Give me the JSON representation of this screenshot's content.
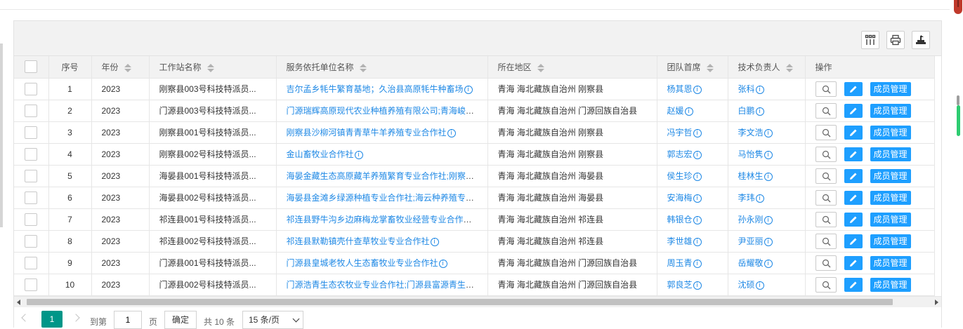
{
  "toolbar": {
    "columns_icon": "columns-icon",
    "print_icon": "print-icon",
    "export_icon": "export-icon"
  },
  "table": {
    "headers": {
      "seq": "序号",
      "year": "年份",
      "station": "工作站名称",
      "service_unit": "服务依托单位名称",
      "region": "所在地区",
      "chief": "团队首席",
      "tech_lead": "技术负责人",
      "ops": "操作"
    },
    "member_label": "成员管理",
    "rows": [
      {
        "seq": "1",
        "year": "2023",
        "station": "刚察县003号科技特派员...",
        "service_unit": "吉尔孟乡牦牛繁育基地；久治县高原牦牛种畜场",
        "region": "青海 海北藏族自治州 刚察县",
        "chief": "杨其恩",
        "tech_lead": "张科"
      },
      {
        "seq": "2",
        "year": "2023",
        "station": "门源县003号科技特派员...",
        "service_unit": "门源瑞辉高原现代农业种植养殖有限公司;青海峻帮农业",
        "region": "青海 海北藏族自治州 门源回族自治县",
        "chief": "赵媛",
        "tech_lead": "白鹏"
      },
      {
        "seq": "3",
        "year": "2023",
        "station": "刚察县001号科技特派员...",
        "service_unit": "刚察县沙柳河镇青青草牛羊养殖专业合作社",
        "region": "青海 海北藏族自治州 刚察县",
        "chief": "冯宇哲",
        "tech_lead": "李文浩"
      },
      {
        "seq": "4",
        "year": "2023",
        "station": "刚察县002号科技特派员...",
        "service_unit": "金山畜牧业合作社",
        "region": "青海 海北藏族自治州 刚察县",
        "chief": "郭志宏",
        "tech_lead": "马怡隽"
      },
      {
        "seq": "5",
        "year": "2023",
        "station": "海晏县001号科技特派员...",
        "service_unit": "海晏金藏生态高原藏羊养殖繁育专业合作社;刚察县沙流",
        "region": "青海 海北藏族自治州 海晏县",
        "chief": "侯生珍",
        "tech_lead": "桂林生"
      },
      {
        "seq": "6",
        "year": "2023",
        "station": "海晏县002号科技特派员...",
        "service_unit": "海晏县金滩乡绿源种植专业合作社;海云种养殖专业合作",
        "region": "青海 海北藏族自治州 海晏县",
        "chief": "安海梅",
        "tech_lead": "李玮"
      },
      {
        "seq": "7",
        "year": "2023",
        "station": "祁连县001号科技特派员...",
        "service_unit": "祁连县野牛沟乡边麻梅龙掌畜牧业经营专业合作社；祁连",
        "region": "青海 海北藏族自治州 祁连县",
        "chief": "韩银仓",
        "tech_lead": "孙永刚"
      },
      {
        "seq": "8",
        "year": "2023",
        "station": "祁连县002号科技特派员...",
        "service_unit": "祁连县默勒镇壳什查草牧业专业合作社",
        "region": "青海 海北藏族自治州 祁连县",
        "chief": "李世雄",
        "tech_lead": "尹亚丽"
      },
      {
        "seq": "9",
        "year": "2023",
        "station": "门源县001号科技特派员...",
        "service_unit": "门源县皇城老牧人生态畜牧业专业合作社",
        "region": "青海 海北藏族自治州 门源回族自治县",
        "chief": "周玉青",
        "tech_lead": "岳耀敬"
      },
      {
        "seq": "10",
        "year": "2023",
        "station": "门源县002号科技特派员...",
        "service_unit": "门源浩青生态农牧业专业合作社;门源县富源青生态养殖",
        "region": "青海 海北藏族自治州 门源回族自治县",
        "chief": "郭良芝",
        "tech_lead": "沈硕"
      }
    ]
  },
  "pager": {
    "current": "1",
    "goto_label": "到第",
    "goto_value": "1",
    "page_label": "页",
    "confirm_label": "确定",
    "total_label": "共 10 条",
    "page_size": "15 条/页"
  },
  "colors": {
    "link": "#1e88e5",
    "primary_button": "#1e9fff",
    "pager_active": "#009688"
  }
}
